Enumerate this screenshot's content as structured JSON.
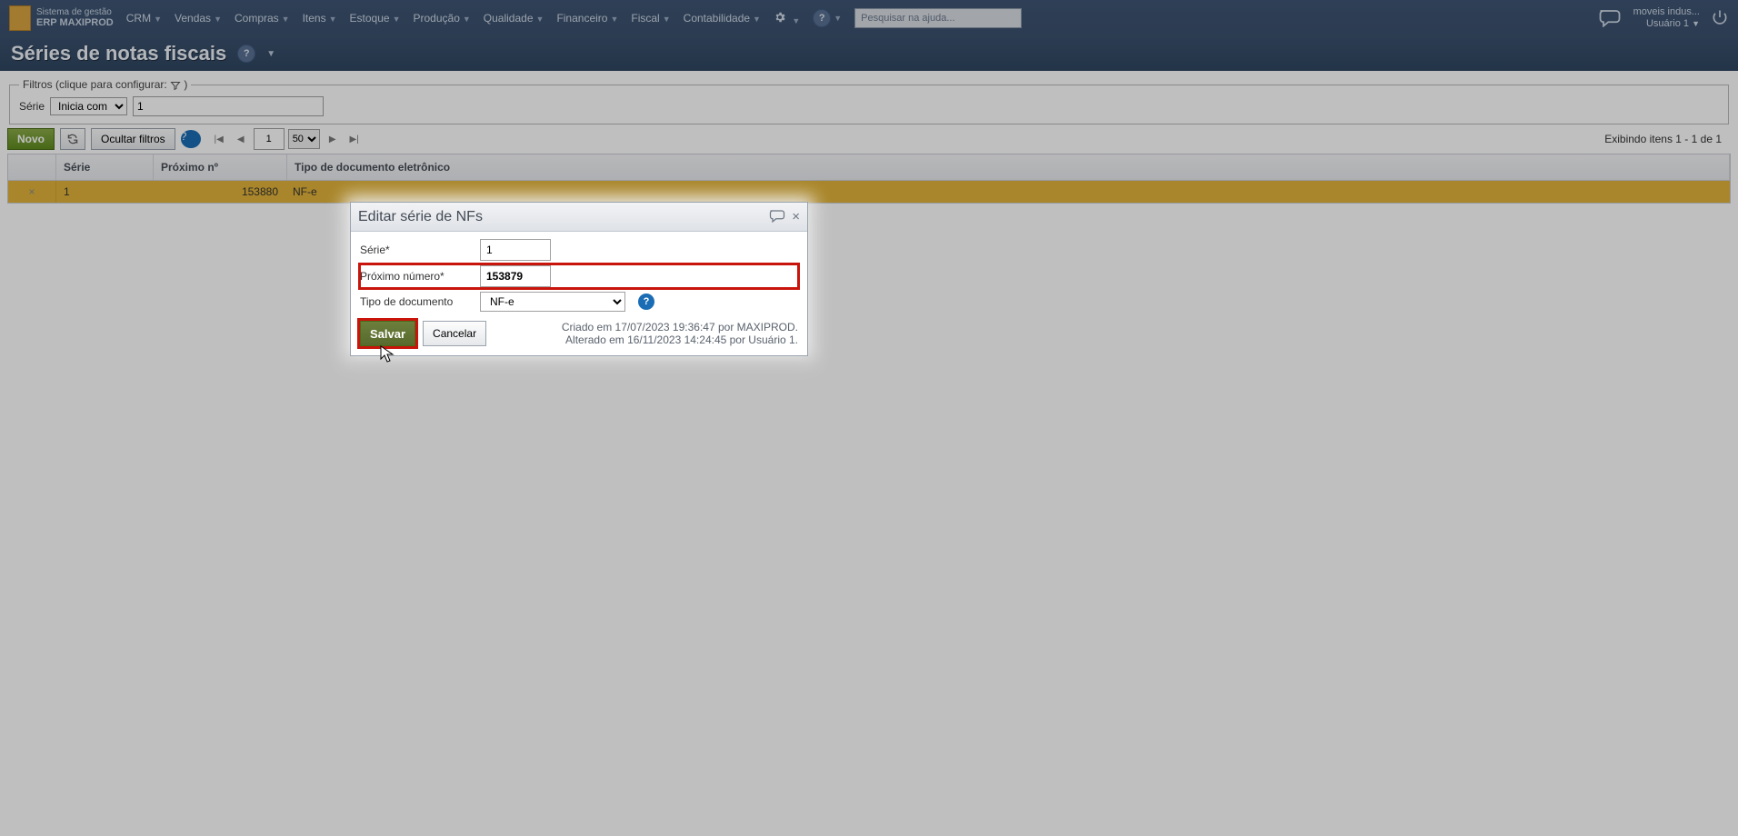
{
  "brand": {
    "line1": "Sistema de gestão",
    "line2": "ERP MAXIPROD"
  },
  "menu": [
    "CRM",
    "Vendas",
    "Compras",
    "Itens",
    "Estoque",
    "Produção",
    "Qualidade",
    "Financeiro",
    "Fiscal",
    "Contabilidade"
  ],
  "help_search_placeholder": "Pesquisar na ajuda...",
  "company": "moveis indus...",
  "user": "Usuário 1",
  "page_title": "Séries de notas fiscais",
  "filters": {
    "legend": "Filtros (clique para configurar:",
    "field_label": "Série",
    "operator": "Inicia com",
    "value": "1"
  },
  "toolbar": {
    "new": "Novo",
    "hide_filters": "Ocultar filtros",
    "page": "1",
    "page_size": "50",
    "results": "Exibindo itens 1 - 1 de 1"
  },
  "grid": {
    "headers": {
      "serie": "Série",
      "proximo": "Próximo nº",
      "tipo": "Tipo de documento eletrônico"
    },
    "row": {
      "serie": "1",
      "proximo": "153880",
      "tipo": "NF-e"
    }
  },
  "modal": {
    "title": "Editar série de NFs",
    "fields": {
      "serie_label": "Série*",
      "serie_value": "1",
      "proximo_label": "Próximo número*",
      "proximo_value": "153879",
      "tipodoc_label": "Tipo de documento",
      "tipodoc_value": "NF-e"
    },
    "buttons": {
      "save": "Salvar",
      "cancel": "Cancelar"
    },
    "meta": {
      "created": "Criado em 17/07/2023 19:36:47 por MAXIPROD.",
      "updated": "Alterado em 16/11/2023 14:24:45 por Usuário 1."
    }
  }
}
